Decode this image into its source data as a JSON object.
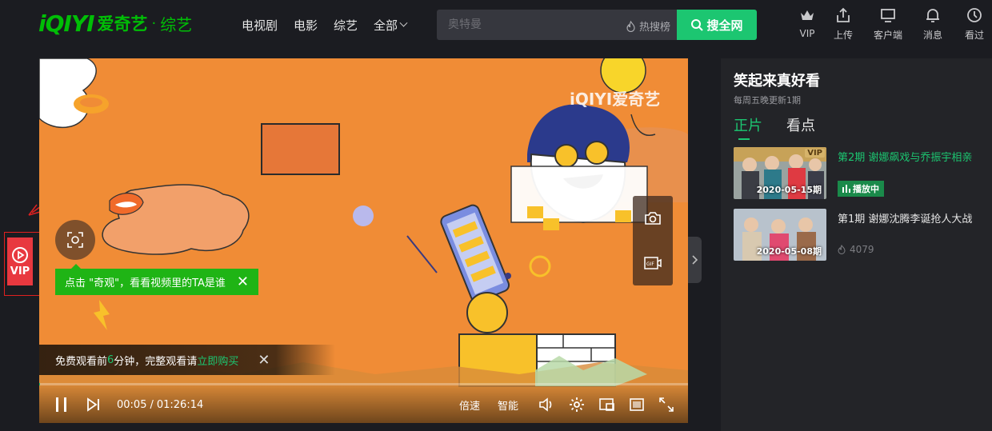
{
  "header": {
    "logo_text": "iQIYI",
    "logo_cn": "爱奇艺",
    "channel": "综艺",
    "nav": [
      {
        "label": "电视剧"
      },
      {
        "label": "电影"
      },
      {
        "label": "综艺"
      },
      {
        "label": "全部"
      }
    ],
    "search": {
      "placeholder": "奥特曼",
      "hot_label": "热搜榜",
      "button_label": "搜全网"
    },
    "icons": [
      {
        "label": "VIP",
        "icon": "crown-icon"
      },
      {
        "label": "上传",
        "icon": "upload-icon"
      },
      {
        "label": "客户端",
        "icon": "monitor-icon"
      },
      {
        "label": "消息",
        "icon": "bell-icon"
      },
      {
        "label": "看过",
        "icon": "clock-icon"
      }
    ]
  },
  "side_widget": {
    "label": "VIP"
  },
  "player": {
    "watermark": "iQIYI爱奇艺",
    "tip": "点击 \"奇观\"，看看视频里的TA是谁",
    "trial": {
      "prefix": "免费观看前",
      "minutes": "6",
      "middle": "分钟，完整观看请",
      "buy": "立即购买"
    },
    "current_time": "00:05",
    "total_time": "01:26:14",
    "progress_fraction": 0.001,
    "speed_label": "倍速",
    "quality_label": "智能"
  },
  "panel": {
    "title": "笑起来真好看",
    "subtitle": "每周五晚更新1期",
    "tabs": [
      "正片",
      "看点"
    ],
    "episodes": [
      {
        "title": "第2期 谢娜飙戏与乔振宇相亲",
        "date": "2020-05-15期",
        "badge": "播放中",
        "vip": "VIP"
      },
      {
        "title": "第1期 谢娜沈腾李诞抢人大战",
        "date": "2020-05-08期",
        "views": "4079"
      }
    ]
  },
  "colors": {
    "accent": "#1cc671",
    "player_bg": "#f08c36",
    "page_bg": "#1b1c21"
  }
}
